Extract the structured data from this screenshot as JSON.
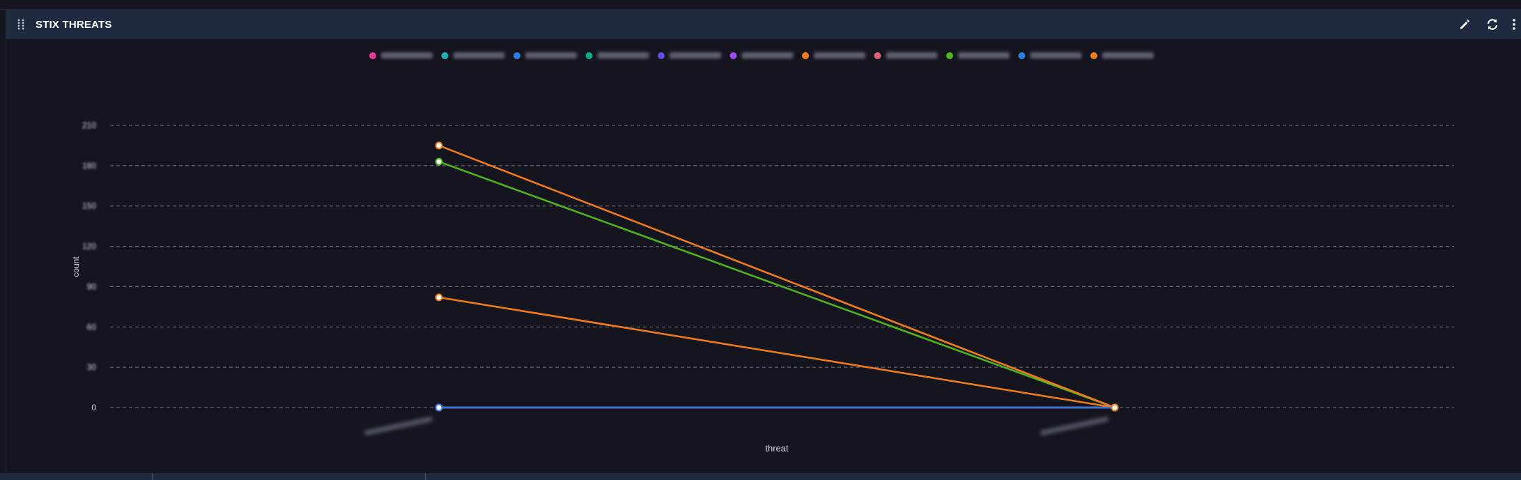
{
  "panel": {
    "title": "STIX THREATS",
    "icons": [
      "drag-handle-icon",
      "pencil-icon",
      "refresh-icon",
      "more-vertical-icon"
    ]
  },
  "colors": {
    "background": "#14151f",
    "header": "#1f2a40",
    "grid": "#c8ccd6",
    "axis_text": "#d8dce6"
  },
  "chart_data": {
    "type": "line",
    "xlabel": "threat",
    "ylabel": "count",
    "categories": [
      "",
      ""
    ],
    "y_ticks": [
      0,
      30,
      60,
      90,
      120,
      150,
      180,
      210
    ],
    "ylim": [
      0,
      210
    ],
    "grid": true,
    "legend_position": "top-center",
    "series": [
      {
        "name": "",
        "color": "#e23b8f",
        "values": [
          0,
          0
        ]
      },
      {
        "name": "",
        "color": "#1fb3b3",
        "values": [
          0,
          0
        ]
      },
      {
        "name": "",
        "color": "#2f7be0",
        "values": [
          0,
          0
        ]
      },
      {
        "name": "",
        "color": "#15a88a",
        "values": [
          0,
          0
        ]
      },
      {
        "name": "",
        "color": "#5b4fe6",
        "values": [
          0,
          0
        ]
      },
      {
        "name": "",
        "color": "#9a4ce8",
        "values": [
          0,
          0
        ]
      },
      {
        "name": "",
        "color": "#f07a1e",
        "values": [
          82,
          0
        ]
      },
      {
        "name": "",
        "color": "#e0607a",
        "values": [
          0,
          0
        ]
      },
      {
        "name": "",
        "color": "#4fb31f",
        "values": [
          183,
          0
        ]
      },
      {
        "name": "",
        "color": "#2f7be0",
        "values": [
          0,
          0
        ]
      },
      {
        "name": "",
        "color": "#f07a1e",
        "values": [
          195,
          0
        ]
      }
    ]
  }
}
